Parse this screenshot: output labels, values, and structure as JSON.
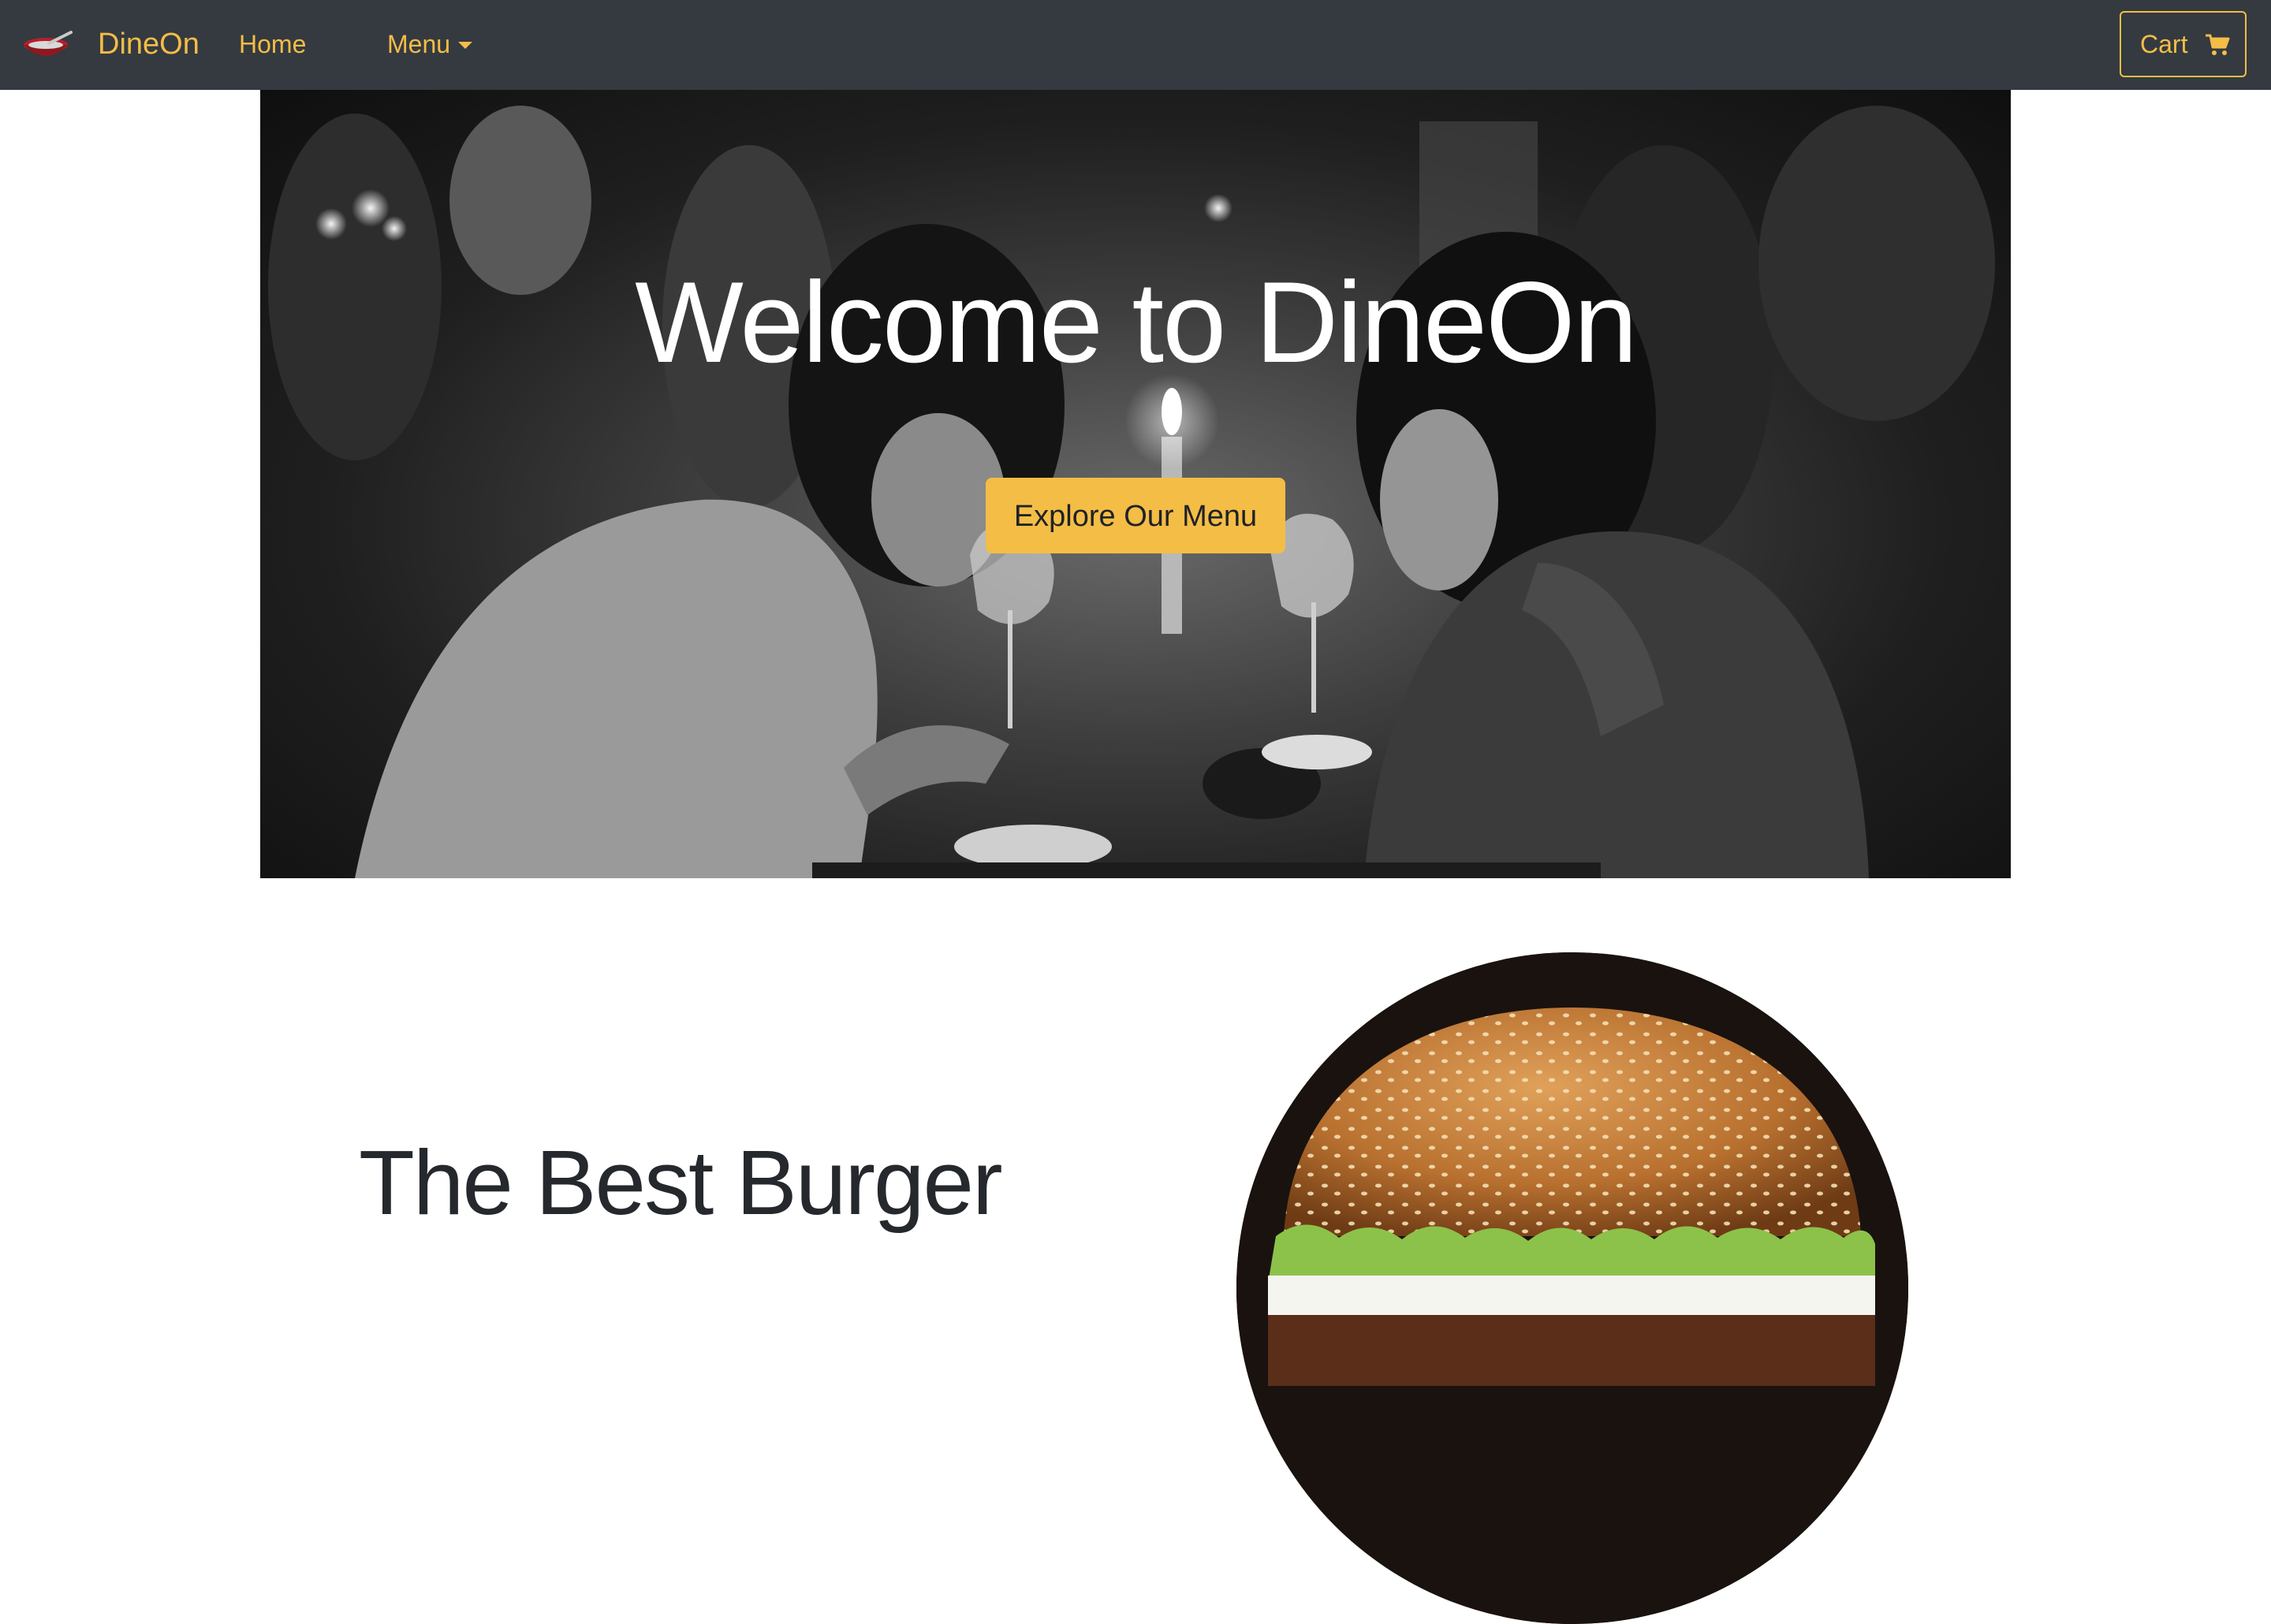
{
  "navbar": {
    "brand_text": "DineOn",
    "brand_icon": "bowl-icon",
    "home_label": "Home",
    "menu_label": "Menu",
    "cart_label": "Cart",
    "cart_icon": "shopping-cart-icon"
  },
  "hero": {
    "title": "Welcome to DineOn",
    "button_label": "Explore Our Menu",
    "image": "restaurant-diners-photo"
  },
  "feature": {
    "title": "The Best Burger",
    "image": "burger-photo"
  },
  "colors": {
    "navbar_bg": "#343a40",
    "accent": "#f4bd46",
    "heading_text": "#25282c",
    "page_bg": "#ffffff"
  }
}
